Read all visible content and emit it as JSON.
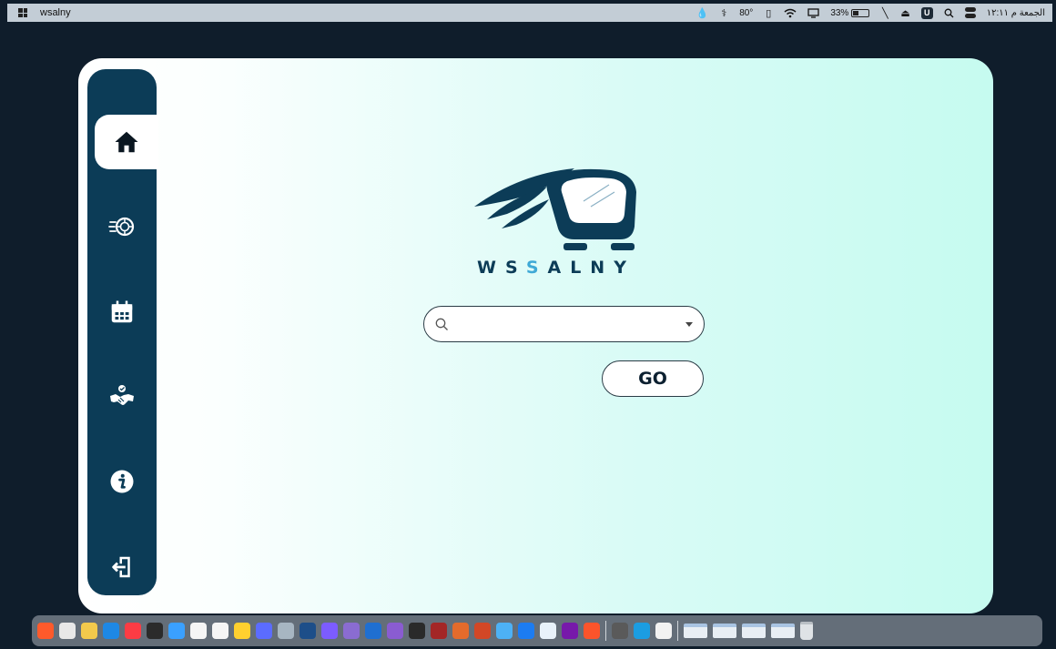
{
  "menubar": {
    "app_name": "wsalny",
    "temperature": "80°",
    "battery": "33%",
    "clock": "الجمعة م ١٢:١١",
    "user_badge": "U"
  },
  "sidebar": {
    "items": [
      {
        "name": "home",
        "icon": "home-icon",
        "active": true
      },
      {
        "name": "car",
        "icon": "wheel-icon",
        "active": false
      },
      {
        "name": "calendar",
        "icon": "calendar-icon",
        "active": false
      },
      {
        "name": "deal",
        "icon": "handshake-icon",
        "active": false
      },
      {
        "name": "info",
        "icon": "info-icon",
        "active": false
      },
      {
        "name": "logout",
        "icon": "logout-icon",
        "active": false
      }
    ]
  },
  "brand": {
    "letters_a": "WS",
    "letters_b": "S",
    "letters_c": "ALNY",
    "primary_color": "#0c3c57",
    "accent_color": "#3fa9d6"
  },
  "search": {
    "value": "",
    "placeholder": ""
  },
  "go_button": {
    "label": "GO"
  },
  "dock": {
    "apps": [
      {
        "icon": "reddit-icon",
        "color": "#ff5a2b"
      },
      {
        "icon": "chrome-icon",
        "color": "#e8e8e8"
      },
      {
        "icon": "photos-icon",
        "color": "#f2c94c"
      },
      {
        "icon": "app-blue-icon",
        "color": "#1e88e5"
      },
      {
        "icon": "music-icon",
        "color": "#fc3c44"
      },
      {
        "icon": "camera-icon",
        "color": "#2b2b2b"
      },
      {
        "icon": "browser-icon",
        "color": "#3aa0ff"
      },
      {
        "icon": "notion-icon",
        "color": "#f5f5f5"
      },
      {
        "icon": "calendar-icon",
        "color": "#f5f5f5"
      },
      {
        "icon": "miro-icon",
        "color": "#ffd02f"
      },
      {
        "icon": "headphones-icon",
        "color": "#5b6cff"
      },
      {
        "icon": "preview-icon",
        "color": "#a7b6c2"
      },
      {
        "icon": "book-icon",
        "color": "#1d4e89"
      },
      {
        "icon": "grid-icon",
        "color": "#7c5cff"
      },
      {
        "icon": "ai-icon",
        "color": "#8a6cd1"
      },
      {
        "icon": "vscode-icon",
        "color": "#1f6fd1"
      },
      {
        "icon": "vs-icon",
        "color": "#8a5cd1"
      },
      {
        "icon": "terminal-icon",
        "color": "#2a2a2a"
      },
      {
        "icon": "dictionary-icon",
        "color": "#a32626"
      },
      {
        "icon": "puzzle-icon",
        "color": "#e46b2c"
      },
      {
        "icon": "powerpoint-icon",
        "color": "#d24726"
      },
      {
        "icon": "folder-icon",
        "color": "#4db1f5"
      },
      {
        "icon": "app-store-icon",
        "color": "#1c7cf2"
      },
      {
        "icon": "draw-icon",
        "color": "#e8f2fb"
      },
      {
        "icon": "onenote-icon",
        "color": "#7719aa"
      },
      {
        "icon": "brave-icon",
        "color": "#fb542b"
      }
    ],
    "apps_right": [
      {
        "icon": "keyboard-icon",
        "color": "#5a5a5a"
      },
      {
        "icon": "edge-icon",
        "color": "#1b9de2"
      },
      {
        "icon": "app-white-icon",
        "color": "#f2f2f2"
      }
    ]
  }
}
